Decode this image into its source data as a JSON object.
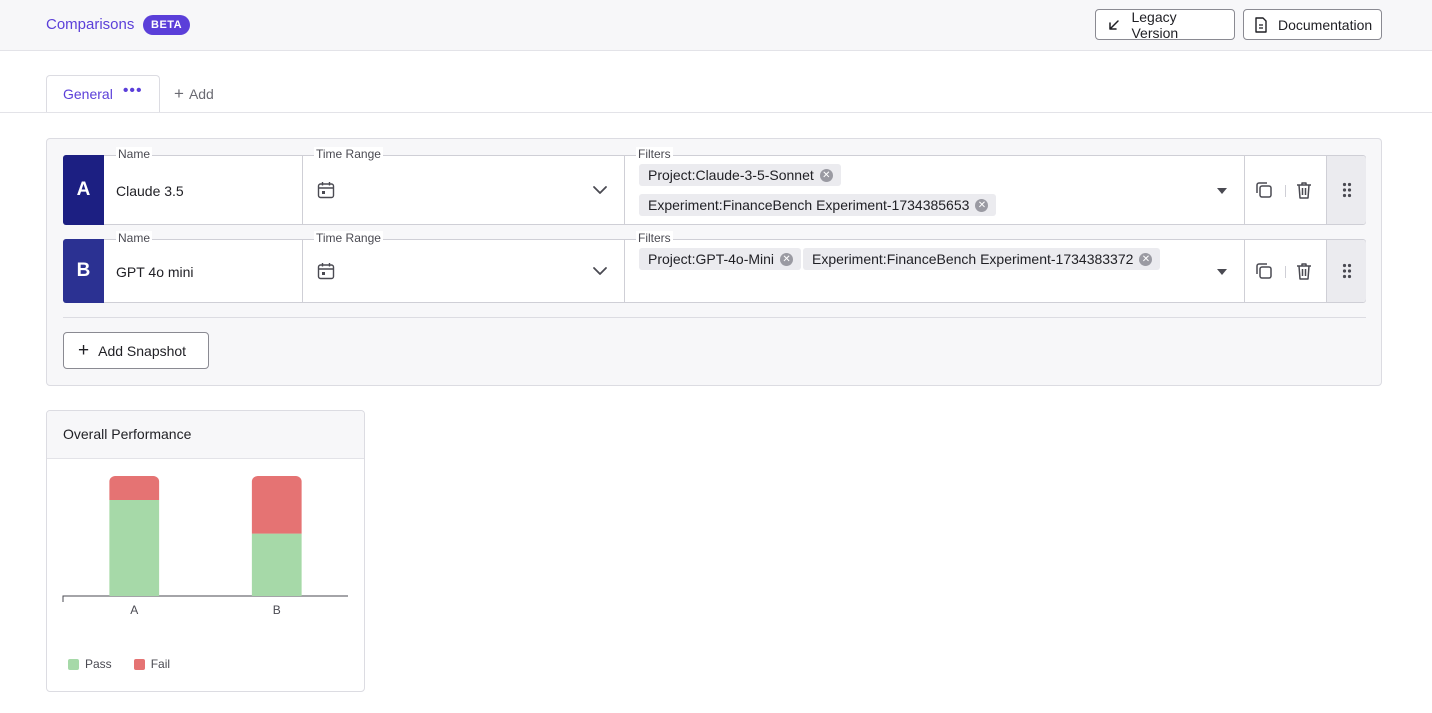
{
  "header": {
    "breadcrumb": "Comparisons",
    "badge": "BETA",
    "legacy_label": "Legacy Version",
    "docs_label": "Documentation"
  },
  "tabs": {
    "items": [
      {
        "label": "General"
      }
    ],
    "add_label": "Add"
  },
  "snapshots": [
    {
      "letter": "A",
      "name_label": "Name",
      "name": "Claude 3.5",
      "time_label": "Time Range",
      "filters_label": "Filters",
      "filters": [
        "Project:Claude-3-5-Sonnet",
        "Experiment:FinanceBench Experiment-1734385653"
      ]
    },
    {
      "letter": "B",
      "name_label": "Name",
      "name": "GPT 4o mini",
      "time_label": "Time Range",
      "filters_label": "Filters",
      "filters": [
        "Project:GPT-4o-Mini",
        "Experiment:FinanceBench Experiment-1734383372"
      ]
    }
  ],
  "add_snapshot_label": "Add Snapshot",
  "colors": {
    "accent": "#5b3fd9",
    "snapshot_a": "#1c1f82",
    "snapshot_b": "#2b3192",
    "pass": "#a6d9a8",
    "fail": "#e57373"
  },
  "chart_data": {
    "type": "bar",
    "stacked": true,
    "title": "Overall Performance",
    "categories": [
      "A",
      "B"
    ],
    "series": [
      {
        "name": "Pass",
        "values": [
          80,
          52
        ],
        "color": "#a6d9a8"
      },
      {
        "name": "Fail",
        "values": [
          20,
          48
        ],
        "color": "#e57373"
      }
    ],
    "ylim": [
      0,
      100
    ],
    "legend": "bottom-left"
  }
}
